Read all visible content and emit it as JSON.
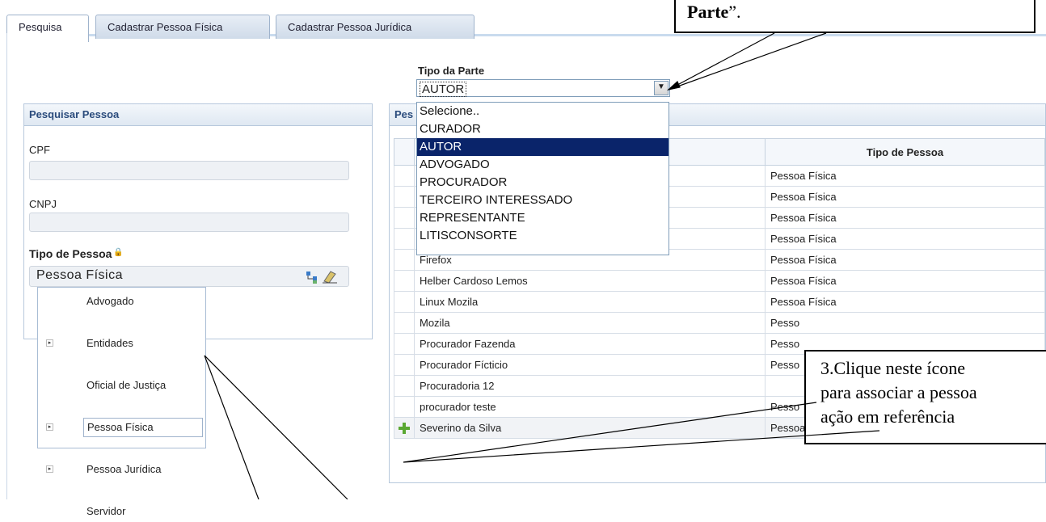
{
  "tabs": [
    "Pesquisa",
    "Cadastrar Pessoa Física",
    "Cadastrar Pessoa Jurídica"
  ],
  "tipo_parte": {
    "label": "Tipo da Parte",
    "value": "AUTOR",
    "options": [
      "Selecione..",
      "CURADOR",
      "AUTOR",
      "ADVOGADO",
      "PROCURADOR",
      "TERCEIRO INTERESSADO",
      "REPRESENTANTE",
      "LITISCONSORTE"
    ],
    "selected_index": 2
  },
  "search_panel": {
    "title": "Pesquisar Pessoa",
    "cpf_label": "CPF",
    "cnpj_label": "CNPJ",
    "tipo_label": "Tipo de Pessoa",
    "tipo_value": "Pessoa Física",
    "tree_items": [
      {
        "label": "Advogado",
        "expandable": false
      },
      {
        "label": "Entidades",
        "expandable": true
      },
      {
        "label": "Oficial de Justiça",
        "expandable": false
      },
      {
        "label": "Pessoa Física",
        "expandable": true
      },
      {
        "label": "Pessoa Jurídica",
        "expandable": true
      },
      {
        "label": "Servidor",
        "expandable": false
      }
    ]
  },
  "results_panel": {
    "title_visible": "Pes",
    "column_tipo": "Tipo de Pessoa",
    "rows": [
      {
        "nome": "",
        "tipo": "Pessoa Física"
      },
      {
        "nome": "",
        "tipo": "Pessoa Física"
      },
      {
        "nome": "",
        "tipo": "Pessoa Física"
      },
      {
        "nome": "",
        "tipo": "Pessoa Física"
      },
      {
        "nome": "Firefox",
        "tipo": "Pessoa Física"
      },
      {
        "nome": "Helber Cardoso Lemos",
        "tipo": "Pessoa Física"
      },
      {
        "nome": "Linux Mozila",
        "tipo": "Pessoa Física"
      },
      {
        "nome": "Mozila",
        "tipo": "Pesso"
      },
      {
        "nome": "Procurador Fazenda",
        "tipo": "Pesso"
      },
      {
        "nome": "Procurador Fícticio",
        "tipo": "Pesso"
      },
      {
        "nome": "Procuradoria 12",
        "tipo": ""
      },
      {
        "nome": "procurador teste",
        "tipo": "Pesso"
      },
      {
        "nome": "Severino da Silva",
        "tipo": "Pessoa Física"
      }
    ]
  },
  "callout_top": {
    "bold": "Parte",
    "rest": "”."
  },
  "callout_right": {
    "lines": [
      "3.Clique neste ícone",
      "para associar a pessoa",
      "ação em referência"
    ]
  }
}
